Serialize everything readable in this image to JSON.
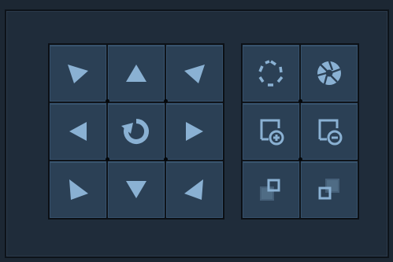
{
  "panel": {
    "ptz_controls": [
      {
        "name": "pan-up-left-button",
        "icon": "arrow-down-right-icon"
      },
      {
        "name": "tilt-up-button",
        "icon": "arrow-up-icon"
      },
      {
        "name": "pan-up-right-button",
        "icon": "arrow-down-left-icon"
      },
      {
        "name": "pan-left-button",
        "icon": "arrow-left-icon"
      },
      {
        "name": "auto-rotate-button",
        "icon": "rotate-icon"
      },
      {
        "name": "pan-right-button",
        "icon": "arrow-right-icon"
      },
      {
        "name": "pan-down-left-button",
        "icon": "arrow-up-right-icon"
      },
      {
        "name": "tilt-down-button",
        "icon": "arrow-down-icon"
      },
      {
        "name": "pan-down-right-button",
        "icon": "arrow-up-left-icon"
      }
    ],
    "lens_controls": [
      {
        "name": "iris-close-button",
        "icon": "aperture-outline-icon"
      },
      {
        "name": "iris-open-button",
        "icon": "aperture-filled-icon"
      },
      {
        "name": "zoom-in-button",
        "icon": "zoom-in-icon"
      },
      {
        "name": "zoom-out-button",
        "icon": "zoom-out-icon"
      },
      {
        "name": "focus-near-button",
        "icon": "focus-near-icon"
      },
      {
        "name": "focus-far-button",
        "icon": "focus-far-icon"
      }
    ]
  },
  "colors": {
    "icon": "#8ab1d3",
    "button": "#2b4055",
    "background": "#1c2733"
  }
}
